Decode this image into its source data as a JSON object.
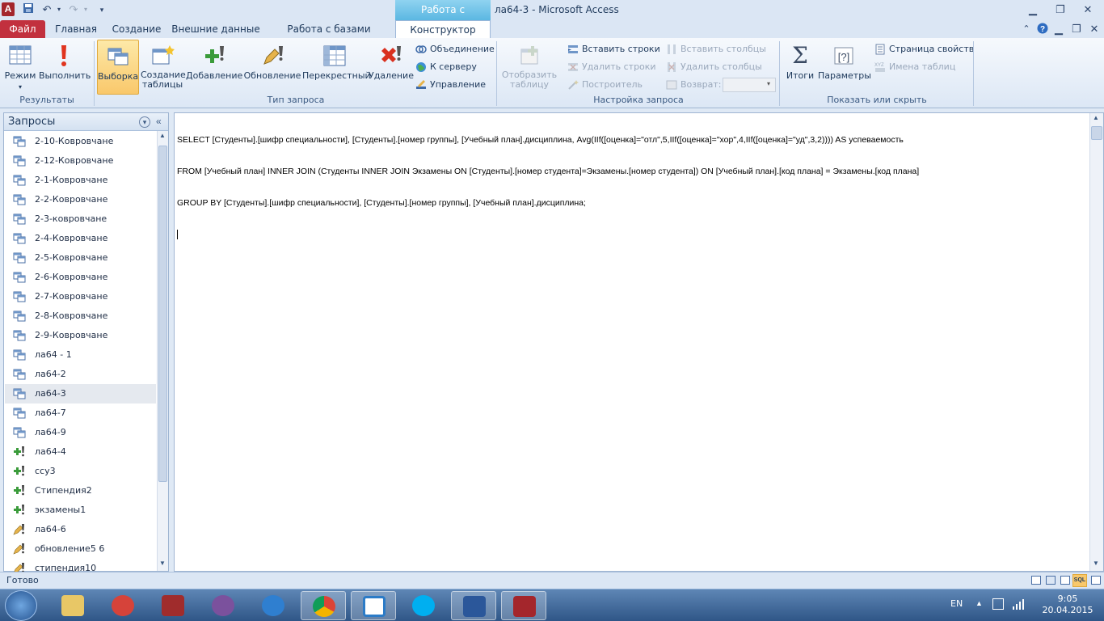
{
  "window": {
    "title": "ла64-3  -  Microsoft Access",
    "context_tab_header": "Работа с запросами"
  },
  "tabs": [
    {
      "label": "Файл"
    },
    {
      "label": "Главная"
    },
    {
      "label": "Создание"
    },
    {
      "label": "Внешние данные"
    },
    {
      "label": "Работа с базами данных"
    },
    {
      "label": "Конструктор"
    }
  ],
  "ribbon": {
    "results": {
      "label": "Результаты",
      "mode": "Режим",
      "run": "Выполнить"
    },
    "query_type": {
      "label": "Тип запроса",
      "select": "Выборка",
      "make_table": "Создание\nтаблицы",
      "append": "Добавление",
      "update": "Обновление",
      "crosstab": "Перекрестный",
      "delete": "Удаление",
      "union": "Объединение",
      "pass_through": "К серверу",
      "data_definition": "Управление"
    },
    "query_setup": {
      "label": "Настройка запроса",
      "show_table": "Отобразить\nтаблицу",
      "insert_rows": "Вставить строки",
      "delete_rows": "Удалить строки",
      "builder": "Построитель",
      "insert_columns": "Вставить столбцы",
      "delete_columns": "Удалить столбцы",
      "return_label": "Возврат:",
      "return_value": ""
    },
    "show_hide": {
      "label": "Показать или скрыть",
      "totals": "Итоги",
      "parameters": "Параметры",
      "property_sheet": "Страница свойств",
      "table_names": "Имена таблиц"
    }
  },
  "nav": {
    "header": "Запросы",
    "items": [
      {
        "label": "2-10-Ковровчане",
        "icon": "select-query-icon"
      },
      {
        "label": "2-12-Ковровчане",
        "icon": "select-query-icon"
      },
      {
        "label": "2-1-Ковровчане",
        "icon": "select-query-icon"
      },
      {
        "label": "2-2-Ковровчане",
        "icon": "select-query-icon"
      },
      {
        "label": "2-3-ковровчане",
        "icon": "select-query-icon"
      },
      {
        "label": "2-4-Ковровчане",
        "icon": "select-query-icon"
      },
      {
        "label": "2-5-Ковровчане",
        "icon": "select-query-icon"
      },
      {
        "label": "2-6-Ковровчане",
        "icon": "select-query-icon"
      },
      {
        "label": "2-7-Ковровчане",
        "icon": "select-query-icon"
      },
      {
        "label": "2-8-Ковровчане",
        "icon": "select-query-icon"
      },
      {
        "label": "2-9-Ковровчане",
        "icon": "select-query-icon"
      },
      {
        "label": "ла64 - 1",
        "icon": "select-query-icon"
      },
      {
        "label": "ла64-2",
        "icon": "select-query-icon"
      },
      {
        "label": "ла64-3",
        "icon": "select-query-icon",
        "selected": true
      },
      {
        "label": "ла64-7",
        "icon": "select-query-icon"
      },
      {
        "label": "ла64-9",
        "icon": "select-query-icon"
      },
      {
        "label": "ла64-4",
        "icon": "append-query-icon"
      },
      {
        "label": "ссу3",
        "icon": "append-query-icon"
      },
      {
        "label": "Стипендия2",
        "icon": "append-query-icon"
      },
      {
        "label": "экзамены1",
        "icon": "append-query-icon"
      },
      {
        "label": "ла64-6",
        "icon": "update-query-icon"
      },
      {
        "label": "обновление5 6",
        "icon": "update-query-icon"
      },
      {
        "label": "стипендия10",
        "icon": "update-query-icon"
      }
    ]
  },
  "editor": {
    "sql_lines": [
      "SELECT [Студенты].[шифр специальности], [Студенты].[номер группы], [Учебный план].дисциплина, Avg(IIf([оценка]=\"отл\",5,IIf([оценка]=\"хор\",4,IIf([оценка]=\"уд\",3,2)))) AS успеваемость",
      "FROM [Учебный план] INNER JOIN (Студенты INNER JOIN Экзамены ON [Студенты].[номер студента]=Экзамены.[номер студента]) ON [Учебный план].[код плана] = Экзамены.[код плана]",
      "GROUP BY [Студенты].[шифр специальности], [Студенты].[номер группы], [Учебный план].дисциплина;"
    ]
  },
  "status": {
    "text": "Готово",
    "sql_view_label": "SQL"
  },
  "taskbar": {
    "language": "EN",
    "time": "9:05",
    "date": "20.04.2015"
  },
  "colors": {
    "file_tab": "#c2303e",
    "context_tab": "#5bb7e2",
    "selected_button": "#f9c86b",
    "taskbar": "#2f5687"
  }
}
